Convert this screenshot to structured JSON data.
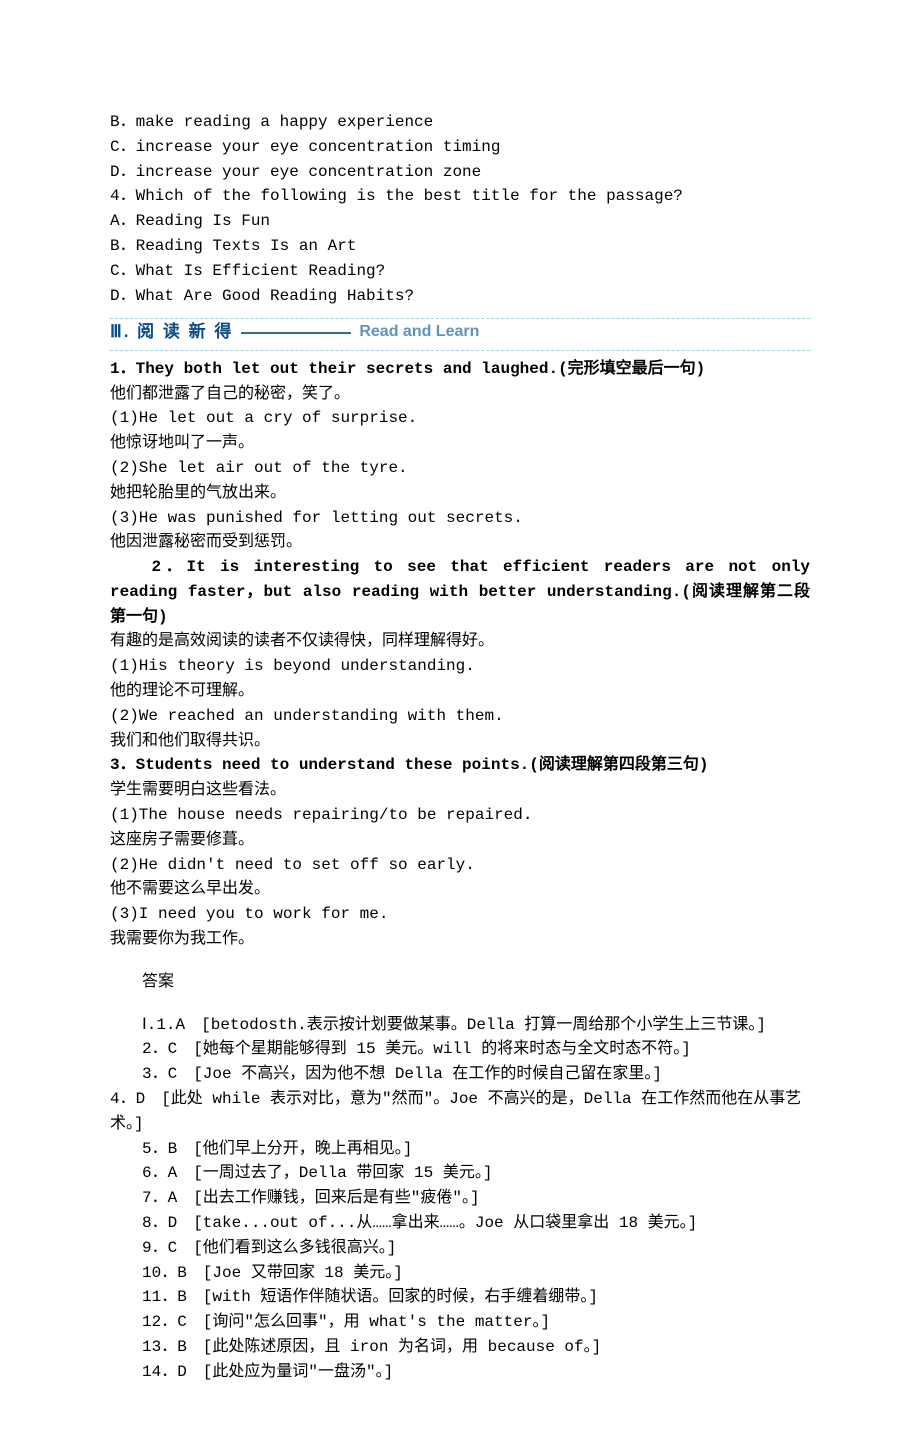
{
  "options": [
    "B．make reading a happy experience",
    "C．increase your eye concentration timing",
    "D．increase your eye concentration zone",
    "4．Which of the following is the best title for the passage?",
    "A．Reading Is Fun",
    "B．Reading Texts Is an Art",
    "C．What Is Efficient Reading?",
    "D．What Are Good Reading Habits?"
  ],
  "section": {
    "num": "Ⅲ. 阅 读 新 得",
    "sub": "Read and Learn"
  },
  "readlearn": [
    {
      "cls": "indent1 bold",
      "text": "1．They both let out their secrets and laughed.(完形填空最后一句)"
    },
    {
      "cls": "indent1",
      "text": "他们都泄露了自己的秘密，笑了。"
    },
    {
      "cls": "indent1 mono",
      "text": "(1)He let out a cry of surprise."
    },
    {
      "cls": "indent1",
      "text": "他惊讶地叫了一声。"
    },
    {
      "cls": "indent1 mono",
      "text": "(2)She let air out of the tyre."
    },
    {
      "cls": "indent1",
      "text": "她把轮胎里的气放出来。"
    },
    {
      "cls": "indent1 mono",
      "text": "(3)He was punished for letting out secrets."
    },
    {
      "cls": "indent1",
      "text": "他因泄露秘密而受到惩罚。"
    },
    {
      "cls": "indent0 bold",
      "text": "　　2．It is interesting to see that efficient readers are not only reading faster，but also reading with better understanding.(阅读理解第二段第一句)"
    },
    {
      "cls": "indent1",
      "text": "有趣的是高效阅读的读者不仅读得快，同样理解得好。"
    },
    {
      "cls": "indent1 mono",
      "text": "(1)His theory is beyond understanding."
    },
    {
      "cls": "indent1",
      "text": "他的理论不可理解。"
    },
    {
      "cls": "indent1 mono",
      "text": "(2)We reached an understanding with them."
    },
    {
      "cls": "indent1",
      "text": "我们和他们取得共识。"
    },
    {
      "cls": "indent1 bold",
      "text": "3．Students need to understand these points.(阅读理解第四段第三句)"
    },
    {
      "cls": "indent1",
      "text": "学生需要明白这些看法。"
    },
    {
      "cls": "indent1 mono",
      "text": "(1)The house needs repairing/to be repaired."
    },
    {
      "cls": "indent1",
      "text": "这座房子需要修葺。"
    },
    {
      "cls": "indent1 mono",
      "text": "(2)He didn't need to set off so early."
    },
    {
      "cls": "indent1",
      "text": "他不需要这么早出发。"
    },
    {
      "cls": "indent1 mono",
      "text": "(3)I need you to work for me."
    },
    {
      "cls": "indent1",
      "text": "我需要你为我工作。"
    }
  ],
  "answers_title": "答案",
  "answers": [
    "Ⅰ.1.A　[betodosth.表示按计划要做某事。Della 打算一周给那个小学生上三节课。]",
    "2．C　[她每个星期能够得到 15 美元。will 的将来时态与全文时态不符。]",
    "3．C　[Joe 不高兴，因为他不想 Della 在工作的时候自己留在家里。]",
    "4．D　[此处 while 表示对比，意为\"然而\"。Joe 不高兴的是，Della 在工作然而他在从事艺术。]",
    "5．B　[他们早上分开，晚上再相见。]",
    "6．A　[一周过去了，Della 带回家 15 美元。]",
    "7．A　[出去工作赚钱，回来后是有些\"疲倦\"。]",
    "8．D　[take...out of...从……拿出来……。Joe 从口袋里拿出 18 美元。]",
    "9．C　[他们看到这么多钱很高兴。]",
    "10．B　[Joe 又带回家 18 美元。]",
    "11．B　[with 短语作伴随状语。回家的时候，右手缠着绷带。]",
    "12．C　[询问\"怎么回事\"，用 what's the matter。]",
    "13．B　[此处陈述原因，且 iron 为名词，用 because of。]",
    "14．D　[此处应为量词\"一盘汤\"。]"
  ]
}
